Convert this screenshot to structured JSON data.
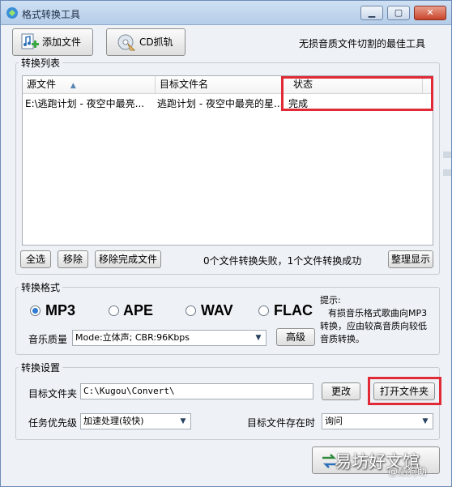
{
  "window": {
    "title": "格式转换工具",
    "min_icon": "minimize-icon",
    "max_icon": "maximize-icon",
    "close_icon": "close-icon"
  },
  "toolbar": {
    "add_file_label": "添加文件",
    "cd_rip_label": "CD抓轨",
    "slogan": "无损音质文件切割的最佳工具"
  },
  "conversion_list": {
    "title": "转换列表",
    "columns": [
      "源文件",
      "目标文件名",
      "状态"
    ],
    "rows": [
      {
        "source": "E:\\逃跑计划 - 夜空中最亮...",
        "target": "逃跑计划 - 夜空中最亮的星...",
        "status": "完成"
      }
    ],
    "select_all_label": "全选",
    "remove_label": "移除",
    "remove_done_label": "移除完成文件",
    "summary": "0个文件转换失败，1个文件转换成功",
    "arrange_label": "整理显示"
  },
  "format": {
    "title": "转换格式",
    "options": [
      "MP3",
      "APE",
      "WAV",
      "FLAC"
    ],
    "selected": "MP3",
    "quality_label": "音乐质量",
    "quality_value": "Mode:立体声; CBR:96Kbps",
    "advanced_label": "高级",
    "hint": [
      "提示:",
      "有损音乐格式歌曲向MP3",
      "转换，应由较高音质向较低",
      "音质转换。"
    ]
  },
  "settings": {
    "title": "转换设置",
    "target_folder_label": "目标文件夹",
    "target_folder_value": "C:\\Kugou\\Convert\\",
    "change_label": "更改",
    "open_folder_label": "打开文件夹",
    "priority_label": "任务优先级",
    "priority_value": "加速处理(较快)",
    "exists_label": "目标文件存在时",
    "exists_value": "询问"
  },
  "watermark": {
    "main": "易坊好文馆",
    "sub": "@酷狗助"
  },
  "colors": {
    "highlight": "#e02a36",
    "radio_selected": "#2e7bd1"
  }
}
